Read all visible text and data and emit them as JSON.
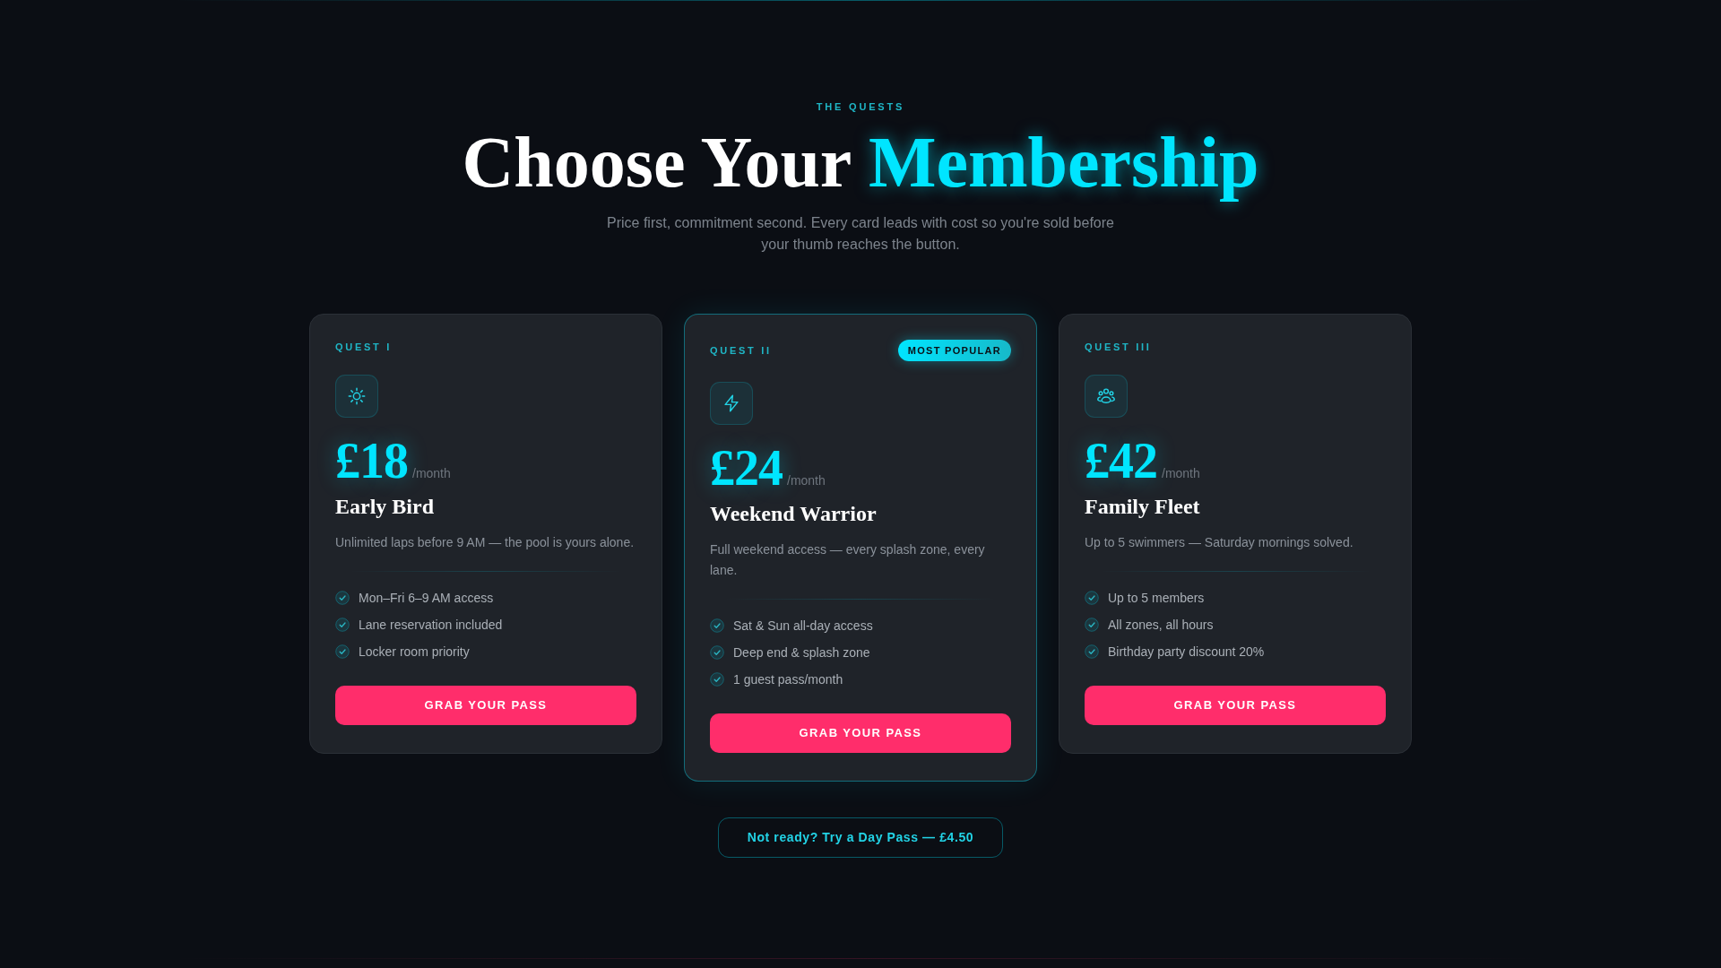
{
  "header": {
    "eyebrow": "THE QUESTS",
    "title": "Choose Your",
    "title_highlight": "Membership",
    "subtitle": "Price first, commitment second. Every card leads with cost so you're sold before your thumb reaches the button."
  },
  "plans": [
    {
      "tier": "QUEST I",
      "featured": false,
      "price": "£18",
      "period": "/month",
      "name": "Early Bird",
      "description": "Unlimited laps before 9 AM — the pool is yours alone.",
      "features": [
        "Mon–Fri 6–9 AM access",
        "Lane reservation included",
        "Locker room priority"
      ],
      "button": "GRAB YOUR PASS"
    },
    {
      "tier": "QUEST II",
      "featured": true,
      "badge": "MOST POPULAR",
      "price": "£24",
      "period": "/month",
      "name": "Weekend Warrior",
      "description": "Full weekend access — every splash zone, every lane.",
      "features": [
        "Sat & Sun all-day access",
        "Deep end & splash zone",
        "1 guest pass/month"
      ],
      "button": "GRAB YOUR PASS"
    },
    {
      "tier": "QUEST III",
      "featured": false,
      "price": "£42",
      "period": "/month",
      "name": "Family Fleet",
      "description": "Up to 5 swimmers — Saturday mornings solved.",
      "features": [
        "Up to 5 members",
        "All zones, all hours",
        "Birthday party discount 20%"
      ],
      "button": "GRAB YOUR PASS"
    }
  ],
  "day_pass": {
    "label": "Not ready? Try a Day Pass — £4.50"
  }
}
